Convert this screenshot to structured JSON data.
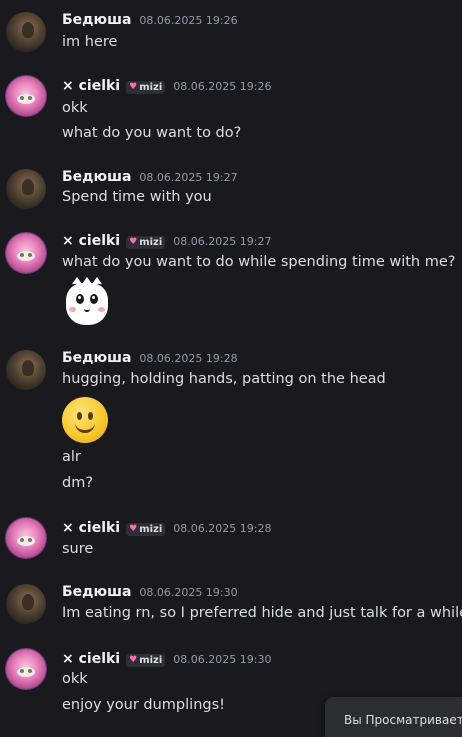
{
  "users": {
    "bedyusha": {
      "name": "Бедюша"
    },
    "cielki": {
      "name": "× cielki",
      "tag_label": "mizi"
    }
  },
  "messages": [
    {
      "author": "Бедюша",
      "time": "08.06.2025 19:26",
      "lines": [
        "im here"
      ]
    },
    {
      "author": "× cielki",
      "time": "08.06.2025 19:26",
      "lines": [
        "okk",
        "what do you want to do?"
      ]
    },
    {
      "author": "Бедюша",
      "time": "08.06.2025 19:27",
      "lines": [
        "Spend time with you"
      ]
    },
    {
      "author": "× cielki",
      "time": "08.06.2025 19:27",
      "lines": [
        "what do you want to do while spending time with me?"
      ],
      "sticker": "white-blob-sticker"
    },
    {
      "author": "Бедюша",
      "time": "08.06.2025 19:28",
      "lines": [
        "hugging, holding hands, patting on the head",
        "alr",
        "dm?"
      ],
      "emoji": "slightly-smiling-face"
    },
    {
      "author": "× cielki",
      "time": "08.06.2025 19:28",
      "lines": [
        "sure"
      ]
    },
    {
      "author": "Бедюша",
      "time": "08.06.2025 19:30",
      "lines": [
        "Im eating rn, so I preferred hide and just talk for a while"
      ]
    },
    {
      "author": "× cielki",
      "time": "08.06.2025 19:30",
      "lines": [
        "okk",
        "enjoy your dumplings!"
      ]
    }
  ],
  "toast": {
    "text": "Вы Просматриваете"
  },
  "colors": {
    "background": "#1a1a1e",
    "text": "#dbdee1",
    "name": "#f2f3f5",
    "timestamp": "#949ba4",
    "tag_heart": "#ff6fae"
  }
}
